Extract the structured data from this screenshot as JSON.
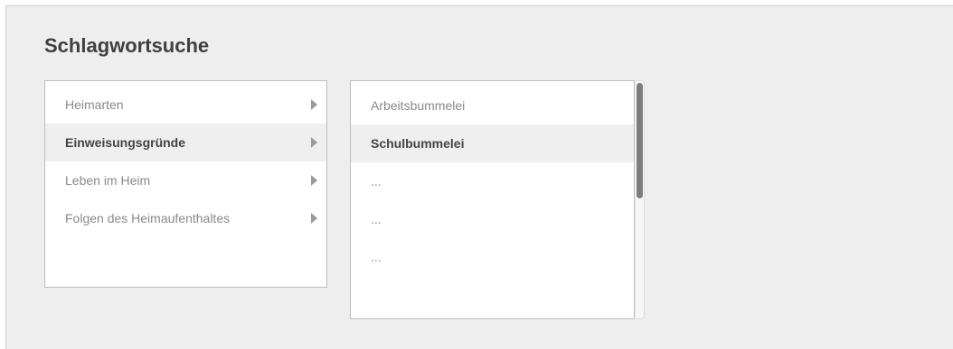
{
  "title": "Schlagwortsuche",
  "categories": {
    "items": [
      {
        "label": "Heimarten"
      },
      {
        "label": "Einweisungsgründe"
      },
      {
        "label": "Leben im Heim"
      },
      {
        "label": "Folgen des Heimaufenthaltes"
      }
    ],
    "selected_index": 1
  },
  "terms": {
    "items": [
      {
        "label": "Arbeitsbummelei"
      },
      {
        "label": "Schulbummelei"
      },
      {
        "label": "..."
      },
      {
        "label": "..."
      },
      {
        "label": "..."
      }
    ],
    "selected_index": 1
  },
  "colors": {
    "panel_background": "#eeeeee",
    "selected_row": "#efefef",
    "scroll_thumb": "#7d7d7d"
  }
}
